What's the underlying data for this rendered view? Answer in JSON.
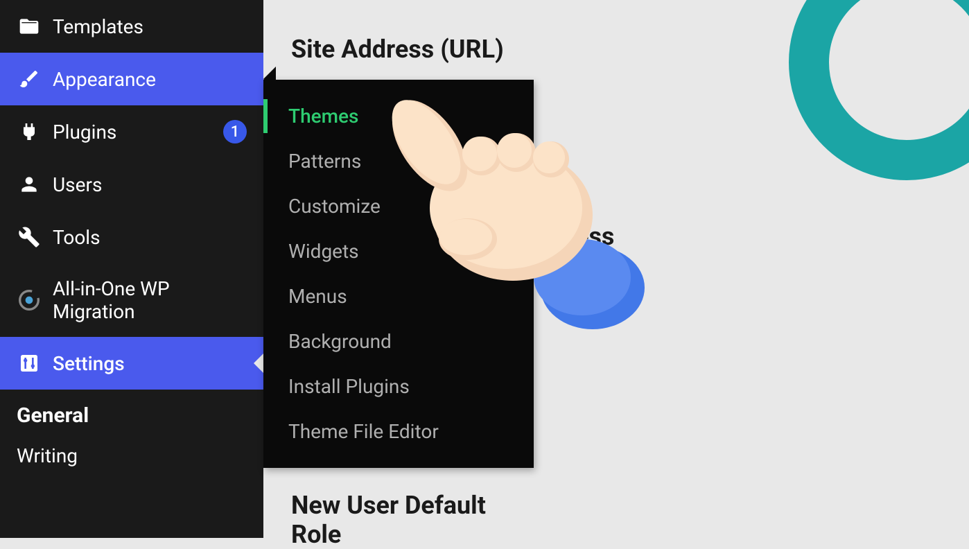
{
  "sidebar": {
    "items": [
      {
        "label": "Templates",
        "icon": "folder-icon"
      },
      {
        "label": "Appearance",
        "icon": "paintbrush-icon",
        "active": true
      },
      {
        "label": "Plugins",
        "icon": "plug-icon",
        "badge": "1"
      },
      {
        "label": "Users",
        "icon": "user-icon"
      },
      {
        "label": "Tools",
        "icon": "wrench-icon"
      },
      {
        "label": "All-in-One WP Migration",
        "icon": "migration-icon"
      },
      {
        "label": "Settings",
        "icon": "sliders-icon",
        "settingsActive": true
      }
    ],
    "submenu": {
      "heading": "General",
      "items": [
        {
          "label": "Writing"
        }
      ]
    }
  },
  "flyout": {
    "items": [
      {
        "label": "Themes",
        "active": true
      },
      {
        "label": "Patterns"
      },
      {
        "label": "Customize"
      },
      {
        "label": "Widgets"
      },
      {
        "label": "Menus"
      },
      {
        "label": "Background"
      },
      {
        "label": "Install Plugins"
      },
      {
        "label": "Theme File Editor"
      }
    ]
  },
  "content": {
    "heading1": "Site Address (URL)",
    "heading2_partial": "ess",
    "heading3_partial": "New User Default Role"
  }
}
